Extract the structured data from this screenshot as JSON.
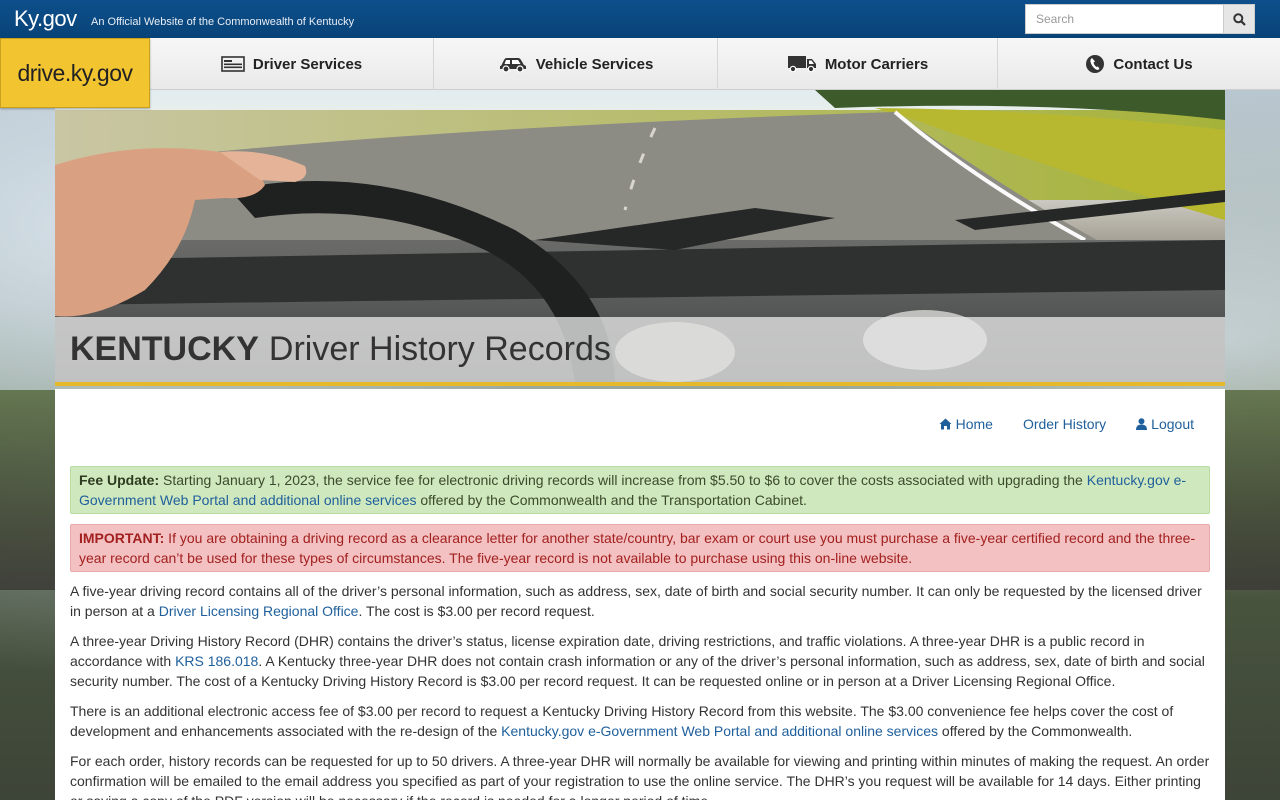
{
  "topbar": {
    "brand": "Ky.gov",
    "tagline": "An Official Website of the Commonwealth of Kentucky",
    "search_placeholder": "Search"
  },
  "logo": {
    "text": "drive.ky.gov"
  },
  "nav": {
    "items": [
      {
        "label": "Driver Services",
        "icon": "id-card-icon"
      },
      {
        "label": "Vehicle Services",
        "icon": "car-icon"
      },
      {
        "label": "Motor Carriers",
        "icon": "truck-icon"
      },
      {
        "label": "Contact Us",
        "icon": "phone-icon"
      }
    ]
  },
  "hero": {
    "title_bold": "KENTUCKY",
    "title_rest": "Driver History Records"
  },
  "subnav": {
    "home": "Home",
    "order_history": "Order History",
    "logout": "Logout"
  },
  "notices": {
    "fee": {
      "label": "Fee Update:",
      "text_before": " Starting January 1, 2023, the service fee for electronic driving records will increase from $5.50 to $6 to cover the costs associated with upgrading the ",
      "link": "Kentucky.gov e-Government Web Portal and additional online services",
      "text_after": " offered by the Commonwealth and the Transportation Cabinet."
    },
    "important": {
      "label": "IMPORTANT:",
      "text": " If you are obtaining a driving record as a clearance letter for another state/country, bar exam or court use you must purchase a five-year certified record and the three-year record can’t be used for these types of circumstances. The five-year record is not available to purchase using this on-line website."
    }
  },
  "paragraphs": {
    "p1_before": "A five-year driving record contains all of the driver’s personal information, such as address, sex, date of birth and social security number. It can only be requested by the licensed driver in person at a ",
    "p1_link": "Driver Licensing Regional Office",
    "p1_after": ". The cost is $3.00 per record request.",
    "p2_before": "A three-year Driving History Record (DHR) contains the driver’s status, license expiration date, driving restrictions, and traffic violations. A three-year DHR is a public record in accordance with ",
    "p2_link": "KRS 186.018",
    "p2_after": ". A Kentucky three-year DHR does not contain crash information or any of the driver’s personal information, such as address, sex, date of birth and social security number. The cost of a Kentucky Driving History Record is $3.00 per record request. It can be requested online or in person at a Driver Licensing Regional Office.",
    "p3_before": "There is an additional electronic access fee of $3.00 per record to request a Kentucky Driving History Record from this website. The $3.00 convenience fee helps cover the cost of development and enhancements associated with the re-design of the ",
    "p3_link": "Kentucky.gov e-Government Web Portal and additional online services",
    "p3_after": " offered by the Commonwealth.",
    "p4": "For each order, history records can be requested for up to 50 drivers. A three-year DHR will normally be available for viewing and printing within minutes of making the request. An order confirmation will be emailed to the email address you specified as part of your registration to use the online service. The DHR’s you request will be available for 14 days. Either printing or saving a copy of the PDF version will be necessary if the record is needed for a longer period of time."
  },
  "colors": {
    "topbar": "#0d4f8b",
    "logo_bg": "#f2c430",
    "link": "#1f5f9c",
    "success_bg": "#cfe8bd",
    "danger_bg": "#f3c1c1",
    "danger_text": "#a32020",
    "accent_gold": "#e6b92a"
  }
}
